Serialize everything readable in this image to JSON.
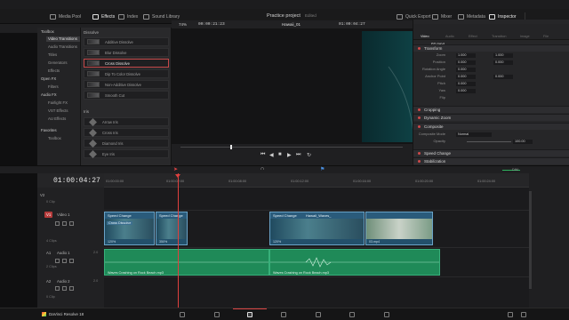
{
  "topbar": {
    "items": [
      {
        "label": "Media Pool",
        "icon": "media-pool-icon",
        "active": false
      },
      {
        "label": "Effects",
        "icon": "effects-icon",
        "active": true
      },
      {
        "label": "Index",
        "icon": "index-icon",
        "active": false
      },
      {
        "label": "Sound Library",
        "icon": "sound-library-icon",
        "active": false
      }
    ],
    "project_title": "Practice project",
    "project_status": "Edited",
    "right_items": [
      {
        "label": "Quick Export",
        "icon": "export-icon"
      },
      {
        "label": "Mixer",
        "icon": "mixer-icon"
      },
      {
        "label": "Metadata",
        "icon": "metadata-icon"
      },
      {
        "label": "Inspector",
        "icon": "inspector-icon",
        "active": true
      }
    ]
  },
  "viewer": {
    "zoom": "74%",
    "source_timecode": "00:00:21:23",
    "clip_name": "Hawaii_01",
    "record_timecode": "01:00:04:27"
  },
  "toolbox": {
    "items": [
      {
        "label": "Toolbox",
        "kind": "head"
      },
      {
        "label": "Video Transitions",
        "kind": "sel"
      },
      {
        "label": "Audio Transitions",
        "kind": "item"
      },
      {
        "label": "Titles",
        "kind": "item"
      },
      {
        "label": "Generators",
        "kind": "item"
      },
      {
        "label": "Effects",
        "kind": "item"
      },
      {
        "label": "Open FX",
        "kind": "head"
      },
      {
        "label": "Filters",
        "kind": "item"
      },
      {
        "label": "Audio FX",
        "kind": "head"
      },
      {
        "label": "Fairlight FX",
        "kind": "item"
      },
      {
        "label": "VST Effects",
        "kind": "item"
      },
      {
        "label": "AU Effects",
        "kind": "item"
      },
      {
        "label": "Favorites",
        "kind": "head"
      },
      {
        "label": "Toolbox",
        "kind": "item"
      }
    ]
  },
  "effects": {
    "group1": "Dissolve",
    "dissolves": [
      "Additive Dissolve",
      "Blur Dissolve",
      "Cross Dissolve",
      "Dip To Color Dissolve",
      "Non-Additive Dissolve",
      "Smooth Cut"
    ],
    "selected_index": 2,
    "group2": "Iris",
    "iris": [
      "Arrow Iris",
      "Cross Iris",
      "Diamond Iris",
      "Eye Iris"
    ]
  },
  "inspector": {
    "tabs": [
      "Video",
      "Audio",
      "Effect",
      "Transition",
      "Image",
      "File"
    ],
    "clip": "02.mp4",
    "sections": [
      "Transform",
      "Cropping",
      "Dynamic Zoom",
      "Composite",
      "Speed Change",
      "Stabilization"
    ],
    "transform": {
      "zoom_label": "Zoom",
      "zoom_x": "1.000",
      "zoom_y": "1.000",
      "position_label": "Position",
      "position_x": "0.000",
      "position_y": "0.000",
      "rotation_label": "Rotation Angle",
      "rotation": "0.000",
      "anchor_label": "Anchor Point",
      "anchor_x": "0.000",
      "anchor_y": "0.000",
      "pitch_label": "Pitch",
      "pitch": "0.000",
      "yaw_label": "Yaw",
      "yaw": "0.000",
      "flip_label": "Flip"
    },
    "composite": {
      "mode_label": "Composite Mode",
      "mode": "Normal",
      "opacity_label": "Opacity",
      "opacity": "100.00"
    }
  },
  "timeline": {
    "timecode": "01:00:04:27",
    "ruler": [
      "01:00:00:00",
      "01:00:02:00",
      "01:00:08:00",
      "01:00:12:00",
      "01:00:16:00",
      "01:00:20:00",
      "01:00:24:00"
    ],
    "tracks": [
      {
        "id": "V2",
        "name": "",
        "sub": "0 Clip"
      },
      {
        "id": "V1",
        "name": "Video 1",
        "sub": "4 Clips"
      },
      {
        "id": "A1",
        "name": "Audio 1",
        "ch": "2.0",
        "sub": "2 Clips"
      },
      {
        "id": "A2",
        "name": "Audio 2",
        "ch": "2.0",
        "sub": "0 Clip"
      }
    ],
    "video_clips": [
      {
        "header": "Speed Change",
        "title": "Cross Dissolve",
        "foot": "120%"
      },
      {
        "header": "Speed Change",
        "title": "",
        "foot": "350%"
      },
      {
        "header": "Speed Change",
        "title": "Hawaii_Waves_",
        "foot": "120%"
      },
      {
        "header": "",
        "title": "",
        "foot": "03.mp4"
      }
    ],
    "audio_clips": [
      {
        "name": "Waves Crashing on Rock Beach.mp3"
      },
      {
        "name": "Waves Crashing on Rock Beach.mp3"
      }
    ],
    "audio_mute_label": "DIM"
  },
  "bottombar": {
    "app_name": "DaVinci Resolve 18",
    "pages": [
      "media",
      "cut",
      "edit",
      "fusion",
      "color",
      "fairlight",
      "deliver"
    ],
    "active_page": 2
  }
}
